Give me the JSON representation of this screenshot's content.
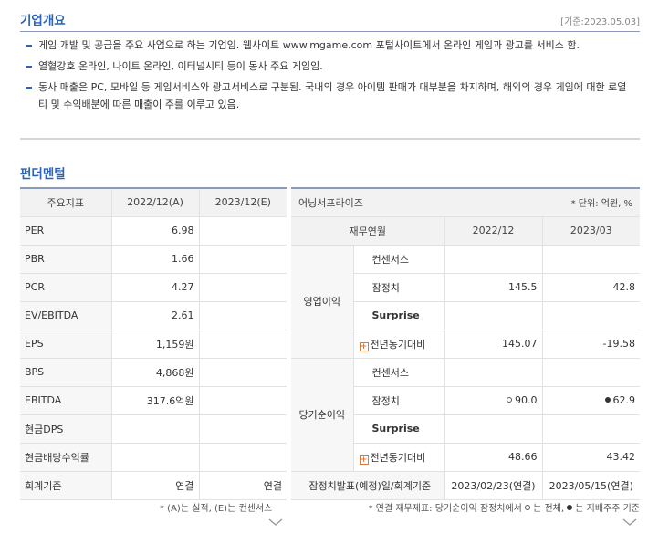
{
  "overview": {
    "title": "기업개요",
    "base_date": "[기준:2023.05.03]",
    "bullets": [
      "게임 개발 및 공급을 주요 사업으로 하는 기업임. 웹사이트 www.mgame.com 포털사이트에서 온라인 게임과 광고를 서비스 함.",
      "열혈강호 온라인, 나이트 온라인, 이터널시티 등이 동사 주요 게임임.",
      "동사 매출은 PC, 모바일 등 게임서비스와 광고서비스로 구분됨. 국내의 경우 아이템 판매가 대부분을 차지하며, 해외의 경우 게임에 대한 로열티 및 수익배분에 따른 매출이 주를 이루고 있음."
    ]
  },
  "fundamental": {
    "title": "펀더멘털",
    "headers": [
      "주요지표",
      "2022/12(A)",
      "2023/12(E)"
    ],
    "rows": [
      {
        "label": "PER",
        "a": "6.98",
        "e": ""
      },
      {
        "label": "PBR",
        "a": "1.66",
        "e": ""
      },
      {
        "label": "PCR",
        "a": "4.27",
        "e": ""
      },
      {
        "label": "EV/EBITDA",
        "a": "2.61",
        "e": ""
      },
      {
        "label": "EPS",
        "a": "1,159원",
        "e": ""
      },
      {
        "label": "BPS",
        "a": "4,868원",
        "e": ""
      },
      {
        "label": "EBITDA",
        "a": "317.6억원",
        "e": ""
      },
      {
        "label": "현금DPS",
        "a": "",
        "e": ""
      },
      {
        "label": "현금배당수익률",
        "a": "",
        "e": ""
      },
      {
        "label": "회계기준",
        "a": "연결",
        "e": "연결"
      }
    ],
    "note": "* (A)는 실적, (E)는 컨센서스"
  },
  "earnings": {
    "title": "어닝서프라이즈",
    "unit": "* 단위: 억원, %",
    "headers": [
      "재무연월",
      "2022/12",
      "2023/03"
    ],
    "operating": {
      "group": "영업이익",
      "rows": [
        {
          "label": "컨센서스",
          "v1": "",
          "v2": ""
        },
        {
          "label": "잠정치",
          "v1": "145.5",
          "v2": "42.8"
        },
        {
          "label": "Surprise",
          "v1": "",
          "v2": ""
        },
        {
          "label": "전년동기대비",
          "v1": "145.07",
          "v2": "-19.58"
        }
      ]
    },
    "net": {
      "group": "당기순이익",
      "rows": [
        {
          "label": "컨센서스",
          "v1": "",
          "v2": ""
        },
        {
          "label": "잠정치",
          "v1": "90.0",
          "v2": "62.9"
        },
        {
          "label": "Surprise",
          "v1": "",
          "v2": ""
        },
        {
          "label": "전년동기대비",
          "v1": "48.66",
          "v2": "43.42"
        }
      ]
    },
    "footer": {
      "label": "잠정치발표(예정)일/회계기준",
      "v1": "2023/02/23(연결)",
      "v2": "2023/05/15(연결)"
    },
    "note_prefix": "* 연결 재무제표: 당기순이익 잠정치에서",
    "note_mid": "는 전체,",
    "note_suffix": "는 지배주주 기준"
  }
}
